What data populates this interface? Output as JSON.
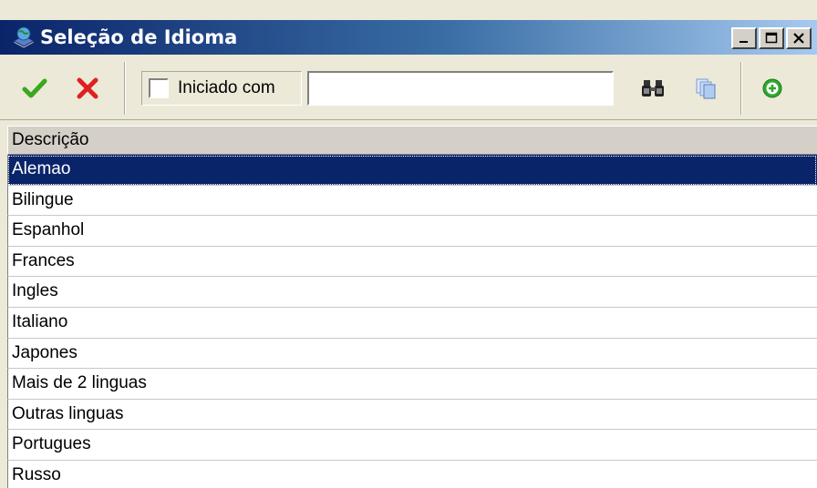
{
  "window": {
    "title": "Seleção de Idioma",
    "title_icon": "book-globe-icon",
    "controls": [
      "minimize-icon",
      "maximize-icon",
      "close-icon"
    ]
  },
  "toolbar": {
    "confirm_icon": "check-icon",
    "cancel_icon": "x-icon",
    "filter": {
      "checkbox_checked": false,
      "label": "Iniciado com"
    },
    "search": {
      "value": "",
      "placeholder": ""
    },
    "find_icon": "binoculars-icon",
    "copy_icon": "copy-pages-icon",
    "add_icon": "add-circle-icon"
  },
  "grid": {
    "columns": [
      "Descrição"
    ],
    "selected_index": 0,
    "rows": [
      "Alemao",
      "Bilingue",
      "Espanhol",
      "Frances",
      "Ingles",
      "Italiano",
      "Japones",
      "Mais de 2 linguas",
      "Outras linguas",
      "Portugues",
      "Russo"
    ]
  },
  "colors": {
    "title_start": "#0a246a",
    "title_end": "#a6caf0",
    "selection": "#0a246a",
    "confirm": "#3aa71e",
    "cancel": "#e02020",
    "add": "#2fa82f"
  }
}
